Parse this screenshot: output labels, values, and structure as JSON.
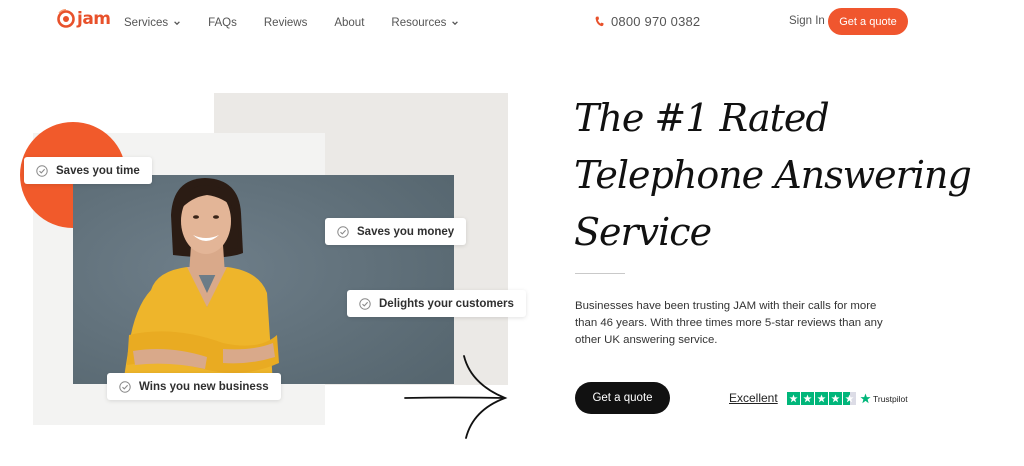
{
  "header": {
    "logo_text": "jam",
    "nav": [
      {
        "label": "Services",
        "dropdown": true
      },
      {
        "label": "FAQs",
        "dropdown": false
      },
      {
        "label": "Reviews",
        "dropdown": false
      },
      {
        "label": "About",
        "dropdown": false
      },
      {
        "label": "Resources",
        "dropdown": true
      }
    ],
    "phone": "0800 970 0382",
    "signin": "Sign In",
    "quote_button": "Get a quote"
  },
  "hero": {
    "badges": {
      "time": "Saves you time",
      "money": "Saves you money",
      "customers": "Delights your customers",
      "business": "Wins you new business"
    },
    "headline_line1": "The #1 Rated",
    "headline_line2": "Telephone Answering",
    "headline_line3": "Service",
    "description": "Businesses have been trusting JAM with their calls for more than 46 years. With three times more 5-star reviews than any other UK answering service.",
    "cta": "Get a quote",
    "rating_label": "Excellent",
    "rating_stars": 4.5,
    "trustpilot": "Trustpilot"
  },
  "colors": {
    "accent": "#f0562e",
    "dark": "#111111",
    "trustpilot_green": "#00b67a"
  }
}
